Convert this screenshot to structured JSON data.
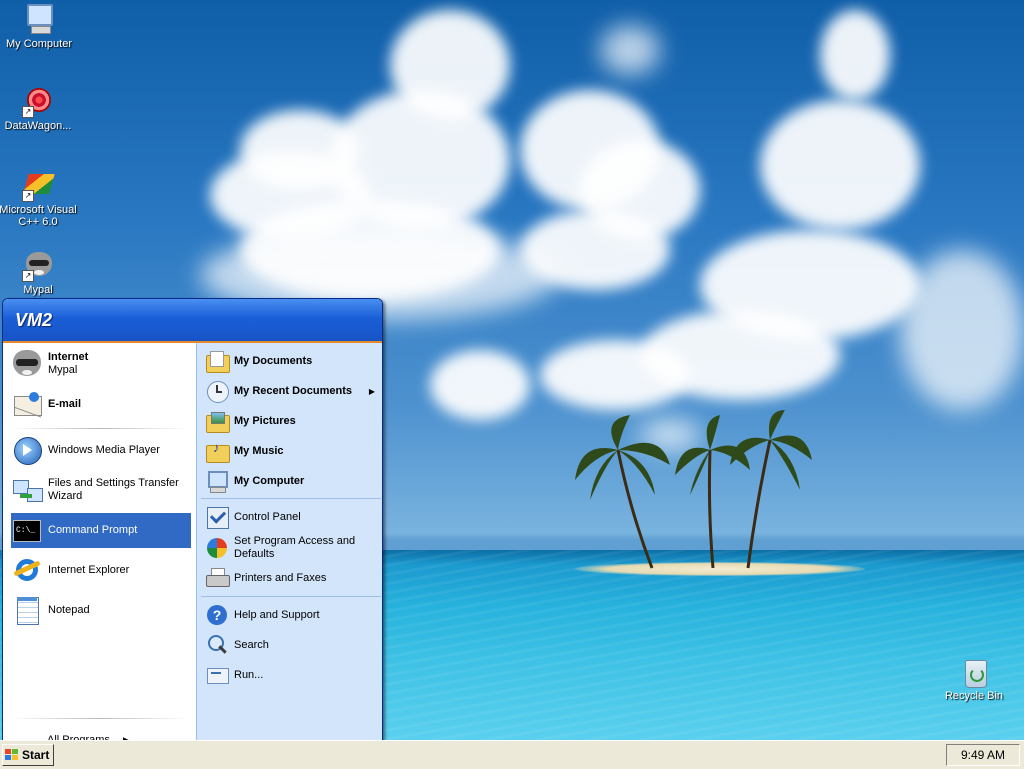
{
  "desktop": {
    "icons": [
      {
        "label": "My Computer",
        "icon": "my-computer-icon"
      },
      {
        "label": "DataWagon...",
        "icon": "datawagon-icon"
      },
      {
        "label": "Microsoft Visual C++ 6.0",
        "icon": "visual-cpp-icon"
      },
      {
        "label": "Mypal",
        "icon": "mypal-icon"
      },
      {
        "label": "Recycle Bin",
        "icon": "recycle-bin-icon"
      }
    ]
  },
  "start_menu": {
    "user_name": "VM2",
    "pinned": [
      {
        "title": "Internet",
        "subtitle": "Mypal",
        "icon": "mypal-icon"
      },
      {
        "title": "E-mail",
        "subtitle": "",
        "icon": "email-icon"
      }
    ],
    "recent": [
      {
        "label": "Windows Media Player",
        "icon": "media-player-icon"
      },
      {
        "label": "Files and Settings Transfer Wizard",
        "icon": "transfer-wizard-icon"
      },
      {
        "label": "Command Prompt",
        "icon": "command-prompt-icon",
        "selected": true
      },
      {
        "label": "Internet Explorer",
        "icon": "internet-explorer-icon"
      },
      {
        "label": "Notepad",
        "icon": "notepad-icon"
      }
    ],
    "all_programs": "All Programs",
    "right_top": [
      {
        "label": "My Documents",
        "icon": "my-documents-icon"
      },
      {
        "label": "My Recent Documents",
        "icon": "recent-documents-icon",
        "has_submenu": true
      },
      {
        "label": "My Pictures",
        "icon": "my-pictures-icon"
      },
      {
        "label": "My Music",
        "icon": "my-music-icon"
      },
      {
        "label": "My Computer",
        "icon": "my-computer-icon"
      }
    ],
    "right_middle": [
      {
        "label": "Control Panel",
        "icon": "control-panel-icon"
      },
      {
        "label": "Set Program Access and Defaults",
        "icon": "program-access-icon"
      },
      {
        "label": "Printers and Faxes",
        "icon": "printer-icon"
      }
    ],
    "right_bottom": [
      {
        "label": "Help and Support",
        "icon": "help-icon"
      },
      {
        "label": "Search",
        "icon": "search-icon"
      },
      {
        "label": "Run...",
        "icon": "run-icon"
      }
    ]
  },
  "taskbar": {
    "start_label": "Start",
    "clock": "9:49 AM"
  },
  "colors": {
    "menu_header": "#1a5fd8",
    "menu_right_pane": "#d3e5fa",
    "selection": "#316ac5",
    "taskbar": "#ece9d8"
  }
}
